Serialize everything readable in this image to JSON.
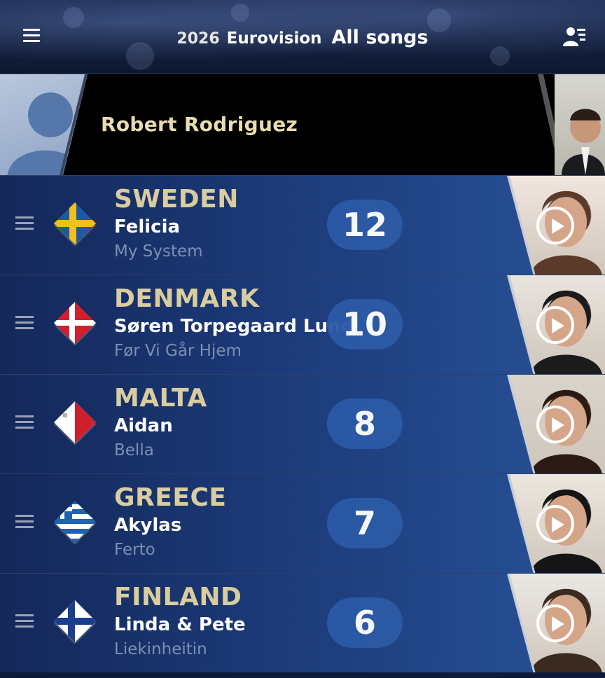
{
  "header": {
    "year": "2026",
    "event": "Eurovision",
    "view": "All songs",
    "menu_icon": "hamburger-menu-icon",
    "profile_icon": "users-icon"
  },
  "voter": {
    "name": "Robert Rodriguez"
  },
  "songs": [
    {
      "country": "SWEDEN",
      "artist": "Felicia",
      "song": "My System",
      "points": "12",
      "flag": "sweden"
    },
    {
      "country": "DENMARK",
      "artist": "Søren Torpegaard Lund",
      "song": "Før Vi Går Hjem",
      "points": "10",
      "flag": "denmark"
    },
    {
      "country": "MALTA",
      "artist": "Aidan",
      "song": "Bella",
      "points": "8",
      "flag": "malta"
    },
    {
      "country": "GREECE",
      "artist": "Akylas",
      "song": "Ferto",
      "points": "7",
      "flag": "greece"
    },
    {
      "country": "FINLAND",
      "artist": "Linda & Pete",
      "song": "Liekinheitin",
      "points": "6",
      "flag": "finland"
    }
  ],
  "colors": {
    "country_gold": "#d9cda0",
    "points_pill": "#2c5aa6",
    "row_blue": "#1c3a78"
  }
}
